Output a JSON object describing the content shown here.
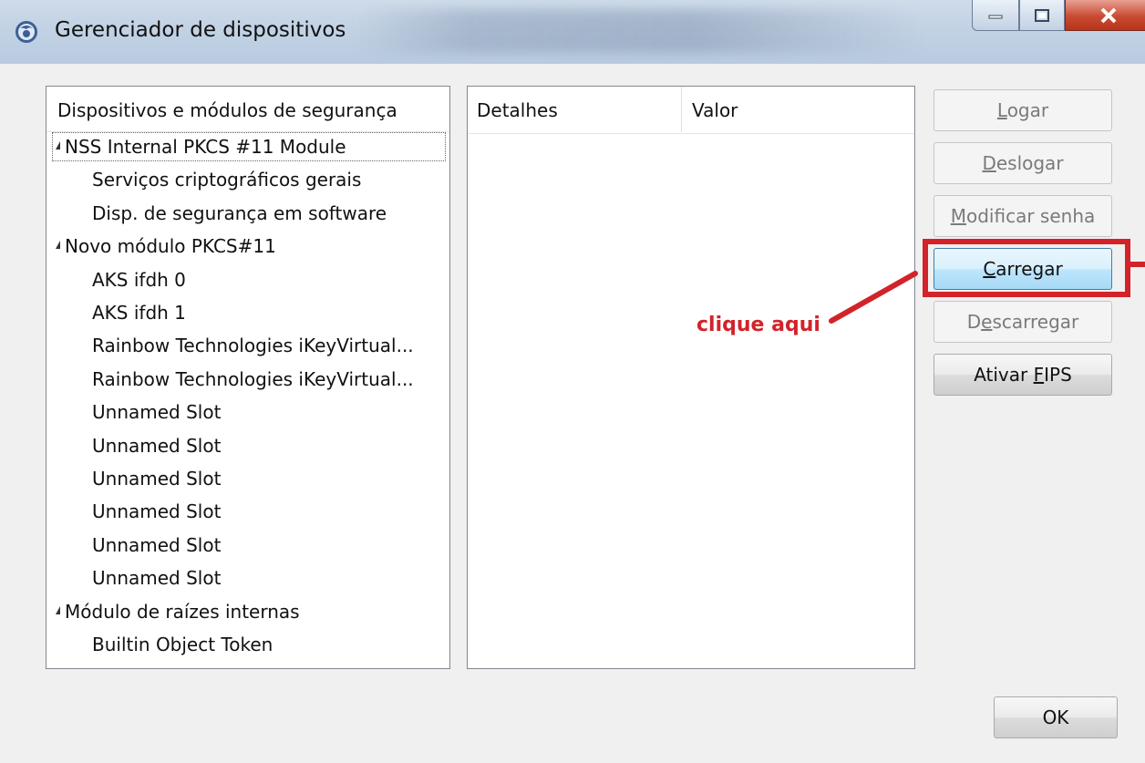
{
  "window": {
    "title": "Gerenciador de dispositivos"
  },
  "tree": {
    "header": "Dispositivos e módulos de segurança",
    "rows": [
      {
        "label": "NSS Internal PKCS #11 Module",
        "level": 0,
        "expanded": true,
        "selected": true
      },
      {
        "label": "Serviços criptográficos gerais",
        "level": 1
      },
      {
        "label": "Disp. de segurança em software",
        "level": 1
      },
      {
        "label": "Novo módulo PKCS#11",
        "level": 0,
        "expanded": true
      },
      {
        "label": "AKS ifdh 0",
        "level": 1
      },
      {
        "label": "AKS ifdh 1",
        "level": 1
      },
      {
        "label": "Rainbow Technologies iKeyVirtual...",
        "level": 1
      },
      {
        "label": "Rainbow Technologies iKeyVirtual...",
        "level": 1
      },
      {
        "label": "Unnamed Slot",
        "level": 1
      },
      {
        "label": "Unnamed Slot",
        "level": 1
      },
      {
        "label": "Unnamed Slot",
        "level": 1
      },
      {
        "label": "Unnamed Slot",
        "level": 1
      },
      {
        "label": "Unnamed Slot",
        "level": 1
      },
      {
        "label": "Unnamed Slot",
        "level": 1
      },
      {
        "label": "Módulo de raízes internas",
        "level": 0,
        "expanded": true
      },
      {
        "label": "Builtin Object Token",
        "level": 1
      }
    ]
  },
  "details": {
    "col_detalhes": "Detalhes",
    "col_valor": "Valor"
  },
  "buttons": {
    "logar": {
      "pre": "",
      "accel": "L",
      "post": "ogar",
      "enabled": false
    },
    "deslogar": {
      "pre": "",
      "accel": "D",
      "post": "eslogar",
      "enabled": false
    },
    "modificar": {
      "pre": "",
      "accel": "M",
      "post": "odificar senha",
      "enabled": false
    },
    "carregar": {
      "pre": "",
      "accel": "C",
      "post": "arregar",
      "enabled": true
    },
    "descarregar": {
      "pre": "D",
      "accel": "e",
      "post": "scarregar",
      "enabled": false
    },
    "fips": {
      "pre": "Ativar ",
      "accel": "F",
      "post": "IPS",
      "enabled": true
    },
    "ok": "OK"
  },
  "annotation": {
    "text": "clique aqui",
    "color": "#d2232a"
  }
}
